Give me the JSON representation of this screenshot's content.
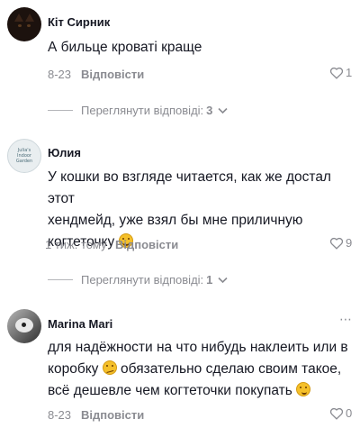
{
  "comments": [
    {
      "author": "Кіт Сирник",
      "text": "А бильце кроваті краще",
      "date": "8-23",
      "reply_label": "Відповісти",
      "likes": "1"
    },
    {
      "author": "Юлия",
      "avatar_text": "Julia's Indoor Garden",
      "text_lines": [
        "У кошки во взгляде читается, как же достал этот",
        "хендмейд, уже взял бы мне приличную",
        "когтеточку"
      ],
      "date": "1 тиж. тому",
      "reply_label": "Відповісти",
      "likes": "9"
    },
    {
      "author": "Marina Mari",
      "text_lines": [
        "для надёжности на что нибудь наклеить или в",
        "коробку",
        "обязательно сделаю своим такое,",
        "всё дешевле чем когтеточки покупать"
      ],
      "date": "8-23",
      "reply_label": "Відповісти",
      "likes": "0",
      "more_menu": "⋯"
    }
  ],
  "view_replies": [
    {
      "label": "Переглянути відповіді:",
      "count": "3"
    },
    {
      "label": "Переглянути відповіді:",
      "count": "1"
    }
  ],
  "icons": {
    "like": "heart-outline-icon",
    "expand": "chevron-down-icon",
    "more": "more-horizontal-icon",
    "emoji_laugh": "laughing-emoji-icon",
    "emoji_think": "thinking-emoji-icon",
    "emoji_sly": "smirk-emoji-icon"
  },
  "colors": {
    "text": "#161823",
    "muted": "#8a8b91",
    "background": "#ffffff"
  }
}
